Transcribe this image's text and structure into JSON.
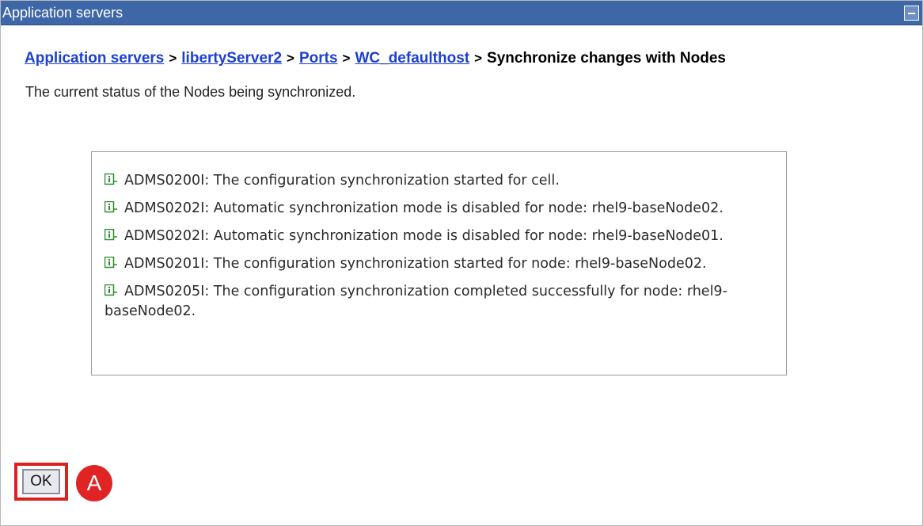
{
  "titlebar": {
    "title": "Application servers"
  },
  "breadcrumb": {
    "links": [
      "Application servers",
      "libertyServer2",
      "Ports",
      "WC_defaulthost"
    ],
    "separator": ">",
    "current": "Synchronize changes with Nodes"
  },
  "description": "The current status of the Nodes being synchronized.",
  "messages": [
    {
      "icon": "info-icon",
      "text": "ADMS0200I: The configuration synchronization started for cell."
    },
    {
      "icon": "info-icon",
      "text": "ADMS0202I: Automatic synchronization mode is disabled for node: rhel9-baseNode02."
    },
    {
      "icon": "info-icon",
      "text": "ADMS0202I: Automatic synchronization mode is disabled for node: rhel9-baseNode01."
    },
    {
      "icon": "info-icon",
      "text": "ADMS0201I: The configuration synchronization started for node: rhel9-baseNode02."
    },
    {
      "icon": "info-icon",
      "text": "ADMS0205I: The configuration synchronization completed successfully for node: rhel9-baseNode02."
    }
  ],
  "ok_button": {
    "label": "OK"
  },
  "annotation": {
    "marker": "A"
  },
  "colors": {
    "titlebar": "#3e67a8",
    "link": "#1c3fd0",
    "highlight": "#dd2020",
    "info_icon": "#2e8b2e"
  }
}
